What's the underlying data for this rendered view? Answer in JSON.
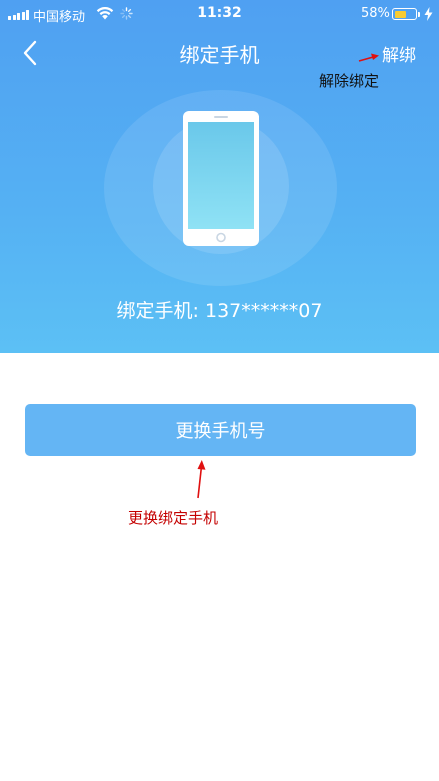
{
  "status_bar": {
    "carrier": "中国移动",
    "time": "11:32",
    "battery_percent": "58%",
    "battery_level": 0.58,
    "signal_icon": "signal-bars-icon",
    "wifi_icon": "wifi-icon",
    "activity_icon": "loading-spinner-icon",
    "charging_icon": "charging-bolt-icon"
  },
  "nav": {
    "back_icon": "chevron-left-icon",
    "title": "绑定手机",
    "unbind_label": "解绑"
  },
  "hero": {
    "illustration_icon": "smartphone-icon",
    "bound_phone_text": "绑定手机: 137******07"
  },
  "actions": {
    "change_phone_label": "更换手机号"
  },
  "annotations": {
    "unbind_note": "解除绑定",
    "change_note": "更换绑定手机"
  },
  "colors": {
    "header_gradient_top": "#4fa0f2",
    "header_gradient_bottom": "#5cc0f5",
    "button_background": "#64b5f4",
    "annotation_red": "#c40000",
    "battery_fill": "#f7cb32"
  }
}
